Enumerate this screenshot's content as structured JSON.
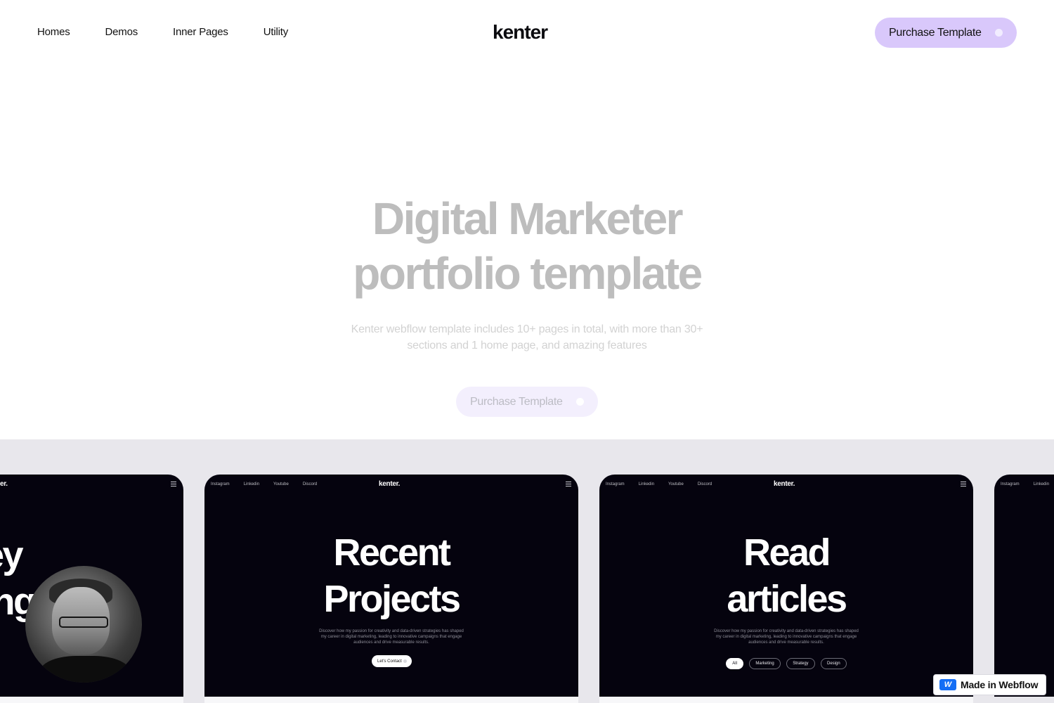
{
  "header": {
    "nav": [
      "Homes",
      "Demos",
      "Inner Pages",
      "Utility"
    ],
    "logo": "kenter",
    "cta_label": "Purchase Template"
  },
  "hero": {
    "title_line1": "Digital Marketer",
    "title_line2": "portfolio template",
    "subtitle_line1": "Kenter webflow template includes 10+ pages in total, with more than 30+",
    "subtitle_line2": "sections and 1 home page, and amazing features",
    "cta_label": "Purchase Template"
  },
  "showcase": {
    "card0": {
      "logo_partial": "er.",
      "text_line1": "ey",
      "text_line2": "ing"
    },
    "card1": {
      "nav": [
        "Instagram",
        "Linkedin",
        "Youtube",
        "Discord"
      ],
      "logo": "kenter.",
      "title_line1": "Recent",
      "title_line2": "Projects",
      "text_line1": "Discover how my passion for creativity and data-driven strategies has shaped",
      "text_line2": "my career in digital marketing, leading to innovative campaigns that engage",
      "text_line3": "audiences and drive measurable results.",
      "button": "Let's Contact"
    },
    "card2": {
      "nav": [
        "Instagram",
        "Linkedin",
        "Youtube",
        "Discord"
      ],
      "logo": "kenter.",
      "title_line1": "Read",
      "title_line2": "articles",
      "text_line1": "Discover how my passion for creativity and data-driven strategies has shaped",
      "text_line2": "my career in digital marketing, leading to innovative campaigns that engage",
      "text_line3": "audiences and drive measurable results.",
      "filters": [
        "All",
        "Marketing",
        "Strategy",
        "Design"
      ]
    },
    "card3": {
      "nav": [
        "Instagram",
        "Linkedin"
      ]
    }
  },
  "badge": {
    "icon": "webflow-logo-icon",
    "label": "Made in Webflow"
  },
  "colors": {
    "accent": "#d9c8fb",
    "card_bg": "#05030e",
    "strip_bg": "#e8e7ec",
    "webflow_blue": "#146ef5"
  }
}
